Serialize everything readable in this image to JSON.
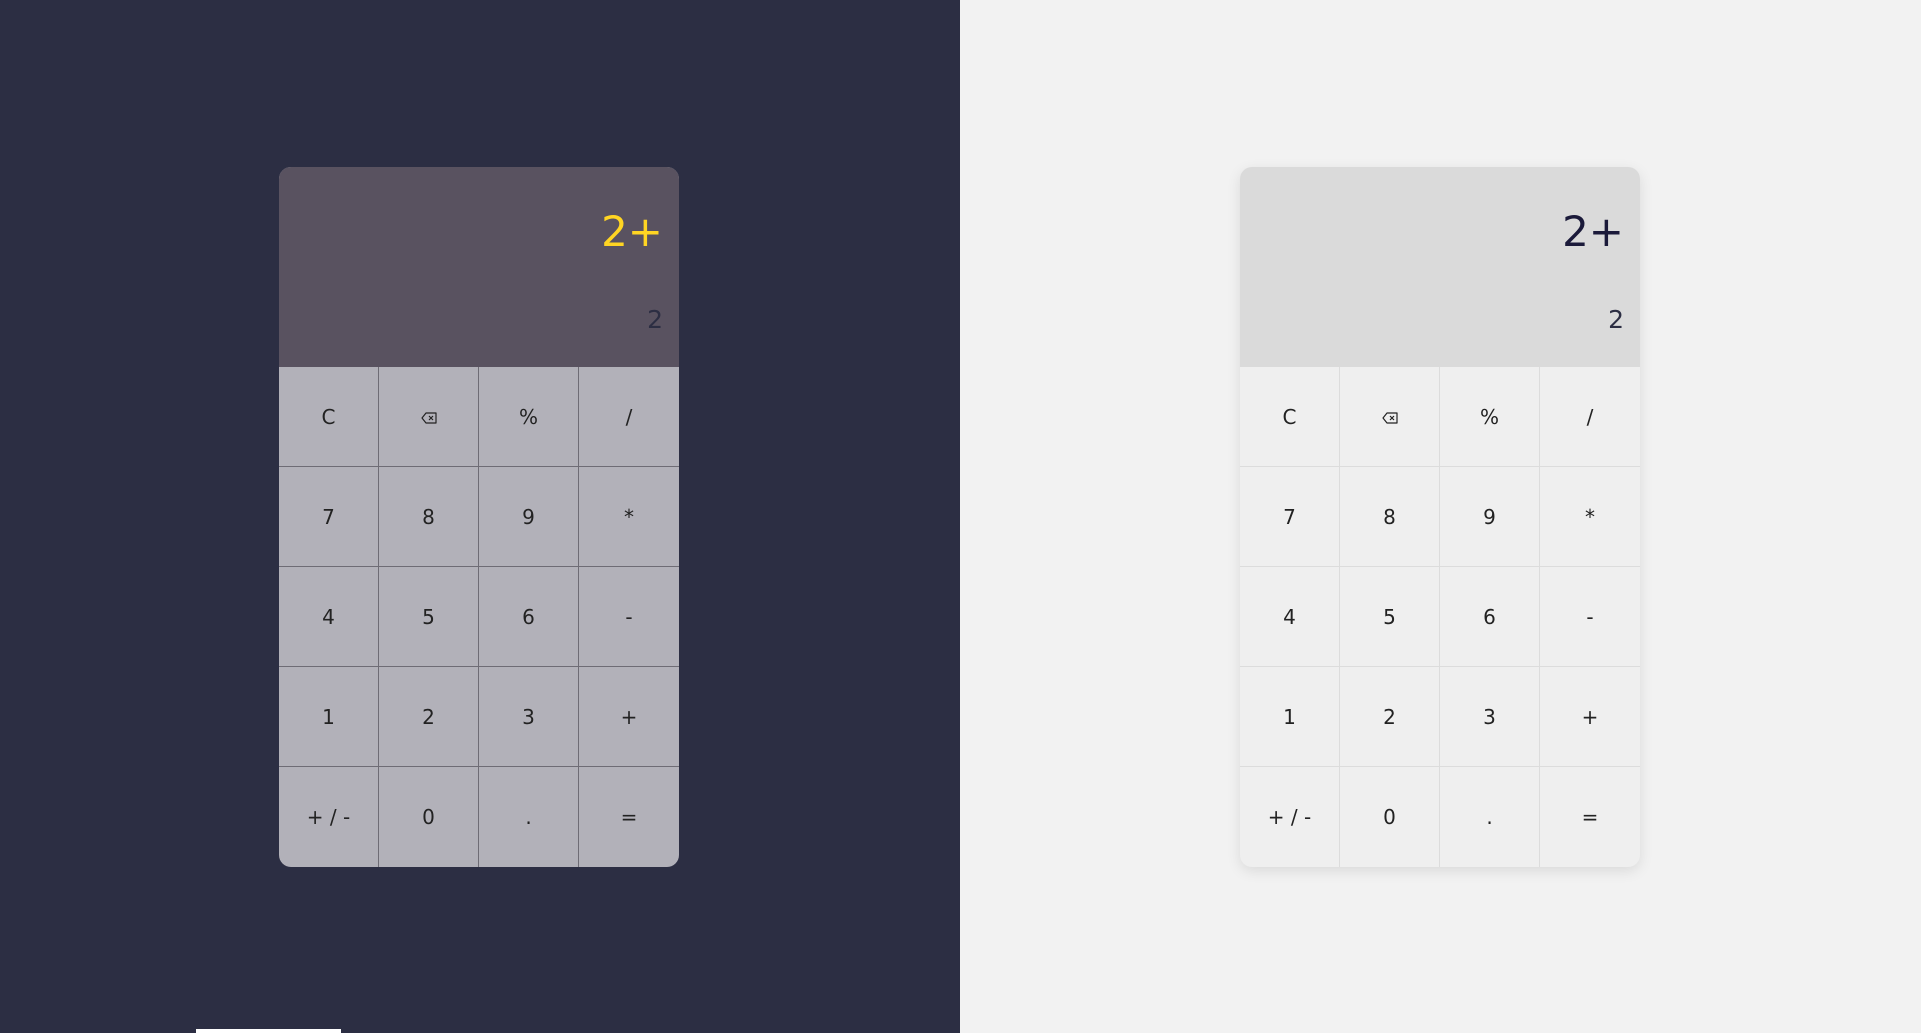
{
  "calculators": [
    {
      "theme": "dark",
      "expression": "2+",
      "current": "2",
      "colors": {
        "page": "#2c2e43",
        "display": "#595260",
        "keypad": "#b2b1b9",
        "expression": "#ffd523"
      }
    },
    {
      "theme": "light",
      "expression": "2+",
      "current": "2",
      "colors": {
        "page": "#f2f2f2",
        "display": "#dadada",
        "keypad": "#efefef",
        "expression": "#1b1a3a"
      }
    }
  ],
  "keys": [
    {
      "label": "C",
      "name": "clear-button"
    },
    {
      "label": "",
      "name": "backspace-button",
      "icon": "backspace-icon"
    },
    {
      "label": "%",
      "name": "percent-button"
    },
    {
      "label": "/",
      "name": "divide-button"
    },
    {
      "label": "7",
      "name": "digit-7-button"
    },
    {
      "label": "8",
      "name": "digit-8-button"
    },
    {
      "label": "9",
      "name": "digit-9-button"
    },
    {
      "label": "*",
      "name": "multiply-button"
    },
    {
      "label": "4",
      "name": "digit-4-button"
    },
    {
      "label": "5",
      "name": "digit-5-button"
    },
    {
      "label": "6",
      "name": "digit-6-button"
    },
    {
      "label": "-",
      "name": "subtract-button"
    },
    {
      "label": "1",
      "name": "digit-1-button"
    },
    {
      "label": "2",
      "name": "digit-2-button"
    },
    {
      "label": "3",
      "name": "digit-3-button"
    },
    {
      "label": "+",
      "name": "add-button"
    },
    {
      "label": "+ / -",
      "name": "negate-button"
    },
    {
      "label": "0",
      "name": "digit-0-button"
    },
    {
      "label": ".",
      "name": "decimal-button"
    },
    {
      "label": "=",
      "name": "equals-button"
    }
  ]
}
